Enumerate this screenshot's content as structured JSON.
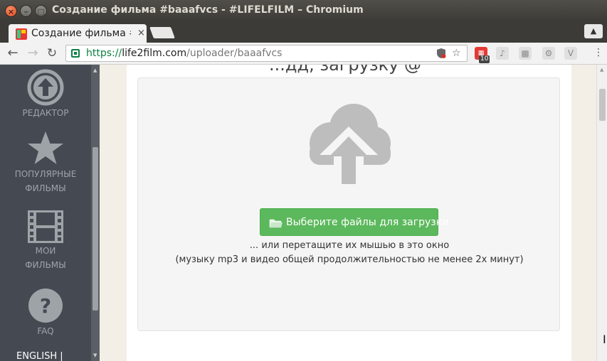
{
  "window": {
    "title": "Создание фильма #baaafvcs - #LIFELFILM – Chromium"
  },
  "tab": {
    "title": "Создание фильма #",
    "close_glyph": "×"
  },
  "toolbar": {
    "back_glyph": "←",
    "forward_glyph": "→",
    "reload_glyph": "↻",
    "url_scheme": "https://",
    "url_host": "life2film.com",
    "url_path": "/uploader/baaafvcs",
    "star_glyph": "☆",
    "ext_badge": "10",
    "menu_glyph": "⋮"
  },
  "sidebar": {
    "items": [
      {
        "label": "РЕДАКТОР",
        "icon": "upload-circle-icon"
      },
      {
        "label_1": "ПОПУЛЯРНЫЕ",
        "label_2": "ФИЛЬМЫ",
        "icon": "star-icon"
      },
      {
        "label_1": "МОИ",
        "label_2": "ФИЛЬМЫ",
        "icon": "film-icon"
      },
      {
        "label": "FAQ",
        "icon": "question-icon"
      }
    ],
    "language": "ENGLISH |"
  },
  "main": {
    "heading_partial": "...дд, загрузку @",
    "upload_button": "Выберите файлы для загрузки",
    "hint_drag": "... или перетащите их мышью в это окно",
    "hint_requirements": "(музыку mp3 и видео общей продолжительностью не менее 2х минут)"
  },
  "colors": {
    "sidebar_bg": "#454a52",
    "sidebar_text": "#9ea3a8",
    "button_green": "#5cb85c",
    "cloud_gray": "#bdbdbd"
  }
}
